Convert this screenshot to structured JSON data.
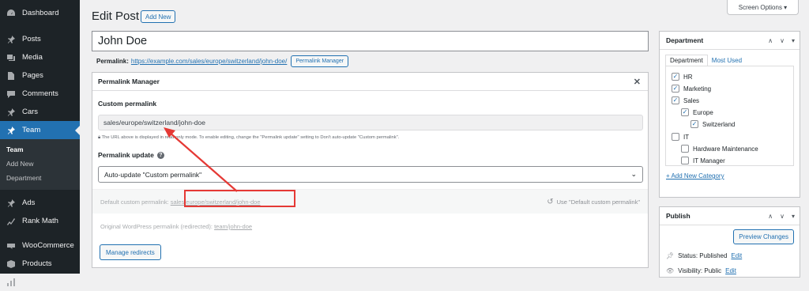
{
  "sidebar": {
    "items": [
      {
        "label": "Dashboard",
        "icon": "dashboard-icon"
      },
      {
        "label": "Posts",
        "icon": "pin-icon"
      },
      {
        "label": "Media",
        "icon": "media-icon"
      },
      {
        "label": "Pages",
        "icon": "page-icon"
      },
      {
        "label": "Comments",
        "icon": "comment-icon"
      },
      {
        "label": "Cars",
        "icon": "pin-icon"
      },
      {
        "label": "Team",
        "icon": "pin-icon"
      }
    ],
    "submenu": [
      "Team",
      "Add New",
      "Department"
    ],
    "items2": [
      {
        "label": "Ads",
        "icon": "pin-icon"
      },
      {
        "label": "Rank Math",
        "icon": "chart-icon"
      },
      {
        "label": "WooCommerce",
        "icon": "woo-icon"
      },
      {
        "label": "Products",
        "icon": "box-icon"
      },
      {
        "label": "Analytics",
        "icon": "bar-chart-icon"
      }
    ]
  },
  "header": {
    "title": "Edit Post",
    "add_new": "Add New",
    "screen_options": "Screen Options ▾"
  },
  "post": {
    "title": "John Doe",
    "permalink_label": "Permalink:",
    "permalink_url": "https://example.com/sales/europe/switzerland/john-doe/",
    "permalink_manager_btn": "Permalink Manager"
  },
  "pm": {
    "title": "Permalink Manager",
    "close": "✕",
    "custom_label": "Custom permalink",
    "custom_value": "sales/europe/switzerland/john-doe",
    "note": "The URL above is displayed in read-only mode. To enable editing, change the \"Permalink update\" setting to Don't auto-update \"Custom permalink\".",
    "update_label": "Permalink update",
    "help": "?",
    "select_value": "Auto-update \"Custom permalink\"",
    "default_label": "Default custom permalink:",
    "default_value": "sales/europe/switzerland/john-doe",
    "use_default": "Use \"Default custom permalink\"",
    "orig_label": "Original WordPress permalink (redirected):",
    "orig_value": "team/john-doe",
    "manage_btn": "Manage redirects"
  },
  "department": {
    "title": "Department",
    "tab_all": "Department",
    "tab_used": "Most Used",
    "cats": [
      {
        "label": "HR",
        "checked": "✓"
      },
      {
        "label": "Marketing",
        "checked": "✓"
      },
      {
        "label": "Sales",
        "checked": "✓"
      },
      {
        "label": "Europe",
        "checked": "✓"
      },
      {
        "label": "Switzerland",
        "checked": "✓"
      },
      {
        "label": "IT",
        "checked": ""
      },
      {
        "label": "Hardware Maintenance",
        "checked": ""
      },
      {
        "label": "IT Manager",
        "checked": ""
      }
    ],
    "add_cat": "+ Add New Category"
  },
  "publish": {
    "title": "Publish",
    "preview": "Preview Changes",
    "status_label": "Status: Published",
    "status_edit": "Edit",
    "visibility_label": "Visibility: Public",
    "visibility_edit": "Edit"
  },
  "panel_controls": {
    "up": "∧",
    "down": "∨",
    "toggle": "▾"
  },
  "colors": {
    "accent": "#2271b1",
    "sidebar": "#1d2327",
    "highlight": "#e53935"
  }
}
